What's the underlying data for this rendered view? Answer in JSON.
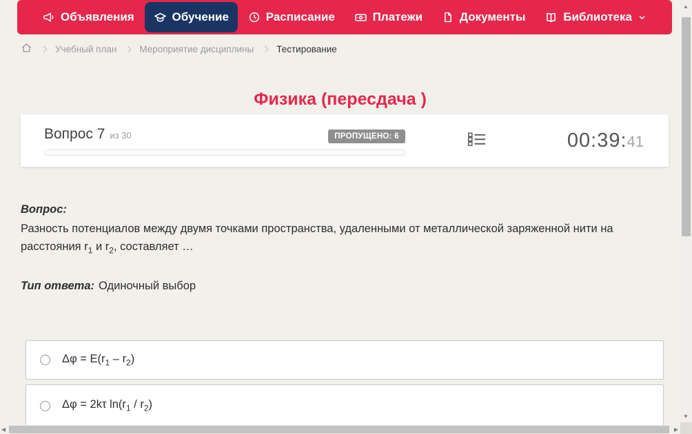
{
  "colors": {
    "accent_red": "#e6274c",
    "active_navy": "#1a3564",
    "badge_gray": "#8f8f8f",
    "page_background": "#f2f0eb"
  },
  "nav": {
    "items": [
      {
        "label": "Объявления",
        "icon": "megaphone-icon",
        "active": false
      },
      {
        "label": "Обучение",
        "icon": "graduation-cap-icon",
        "active": true
      },
      {
        "label": "Расписание",
        "icon": "clock-icon",
        "active": false
      },
      {
        "label": "Платежи",
        "icon": "banknote-icon",
        "active": false
      },
      {
        "label": "Документы",
        "icon": "document-icon",
        "active": false
      },
      {
        "label": "Библиотека",
        "icon": "book-icon",
        "active": false,
        "dropdown_icon": "chevron-down-icon"
      }
    ]
  },
  "breadcrumb": {
    "home_icon": "home-icon",
    "items": [
      {
        "label": "Учебный план",
        "current": false
      },
      {
        "label": "Мероприятие дисциплины",
        "current": false
      },
      {
        "label": "Тестирование",
        "current": true
      }
    ]
  },
  "page": {
    "title": "Физика (пересдача )"
  },
  "quiz_header": {
    "question_number": "Вопрос 7",
    "question_total": "из 30",
    "skipped_badge": "ПРОПУЩЕНО: 6",
    "progress_percent": 0,
    "question_list_icon": "question-list-icon",
    "timer": {
      "hours_minutes": "00:39:",
      "seconds": "41"
    }
  },
  "question": {
    "label": "Вопрос:",
    "text": [
      {
        "t": "Разность потенциалов между двумя точками пространства, удаленными от металлической заряженной нити на расстояния r"
      },
      {
        "s": "1"
      },
      {
        "t": " и r"
      },
      {
        "s": "2"
      },
      {
        "t": ", составляет …"
      }
    ],
    "answer_type_label": "Тип ответа:",
    "answer_type_value": "Одиночный выбор"
  },
  "options": [
    {
      "formula": [
        {
          "t": "Δφ = E(r"
        },
        {
          "s": "1"
        },
        {
          "t": " – r"
        },
        {
          "s": "2"
        },
        {
          "t": ")"
        }
      ]
    },
    {
      "formula": [
        {
          "t": "Δφ = 2kτ ln(r"
        },
        {
          "s": "1"
        },
        {
          "t": " / r"
        },
        {
          "s": "2"
        },
        {
          "t": ")"
        }
      ]
    }
  ]
}
